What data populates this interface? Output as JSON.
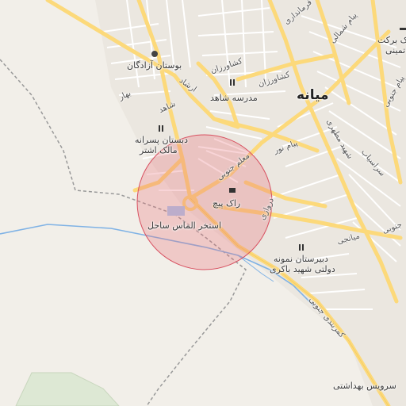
{
  "map": {
    "city_label": "میانه",
    "labels": {
      "bostan": "بوستان آزادگان",
      "madrese_shahed": "مدرسه شاهد",
      "dabestan_line1": "دبستان پسرانه",
      "dabestan_line2": "مالک اشتر",
      "rak_pich": "راک پیچ",
      "estakhr": "استخر الماس ساحل",
      "dabirestan_line1": "دبیرستان نمونه",
      "dabirestan_line2": "دولتی شهید باکری",
      "servis": "سرویس بهداشتی",
      "bank_line1": "بانک برکت",
      "bank_line2": "تمینی"
    },
    "roads": {
      "keshavarzan1": "کشاورزان",
      "keshavarzan2": "کشاورزان",
      "ershad": "ارشاد",
      "shahed": "شاهد",
      "bahar": "بهار",
      "payam_noor": "پیام نور",
      "moalem_jonoobi": "معلم جنوبی",
      "shahid_motahari": "شهید مطهری",
      "sarasiab": "سراسیاب",
      "payam_jonoobi": "پیام جنوبی",
      "darvazi": "دروازی",
      "miyaneji": "میانجی",
      "komarbandi": "کمربندی جنوبی",
      "farmandari": "فرمانداری",
      "shomali": "پیام شمالی",
      "jonoobi_right": "جنوبی"
    },
    "colors": {
      "background": "#f2efe9",
      "major_road": "#fcd97a",
      "minor_road": "#ffffff",
      "river": "#7fb2e5",
      "highlight": "#e8707a",
      "rail": "#999999"
    }
  }
}
